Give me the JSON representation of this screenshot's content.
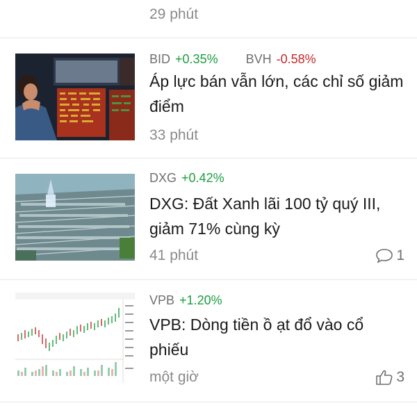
{
  "feed": {
    "top_time": "29 phút",
    "items": [
      {
        "tickers": [
          {
            "symbol": "BID",
            "change": "+0.35%",
            "dir": "up"
          },
          {
            "symbol": "BVH",
            "change": "-0.58%",
            "dir": "down"
          }
        ],
        "title": "Áp lực bán vẫn lớn, các chỉ số giảm điểm",
        "time": "33 phút",
        "thumbnail_icon": "stock-trader-photo"
      },
      {
        "tickers": [
          {
            "symbol": "DXG",
            "change": "+0.42%",
            "dir": "up"
          }
        ],
        "title": "DXG: Đất Xanh lãi 100 tỷ quý III, giảm 71% cùng kỳ",
        "time": "41 phút",
        "comments": "1",
        "thumbnail_icon": "real-estate-aerial-photo"
      },
      {
        "tickers": [
          {
            "symbol": "VPB",
            "change": "+1.20%",
            "dir": "up"
          }
        ],
        "title": "VPB: Dòng tiền ồ ạt đổ vào cổ phiếu",
        "time": "một giờ",
        "likes": "3",
        "thumbnail_icon": "candlestick-chart-screenshot"
      }
    ]
  },
  "colors": {
    "up": "#1a9e3f",
    "down": "#c62828",
    "muted": "#8a8a8a",
    "divider": "#e6e6e6"
  }
}
